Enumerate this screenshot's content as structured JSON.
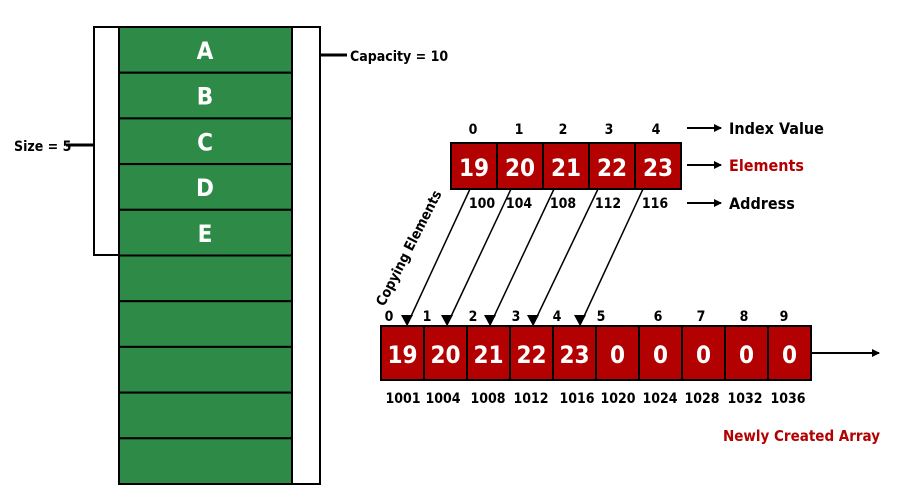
{
  "colors": {
    "green": "#2e8b47",
    "red": "#b30000",
    "label_red": "#b30000",
    "stroke": "#000000"
  },
  "capacity_stack": {
    "cells": [
      "A",
      "B",
      "C",
      "D",
      "E",
      "",
      "",
      "",
      "",
      ""
    ],
    "size_label": "Size = 5",
    "capacity_label": "Capacity = 10"
  },
  "old_array": {
    "indices": [
      "0",
      "1",
      "2",
      "3",
      "4"
    ],
    "elements": [
      "19",
      "20",
      "21",
      "22",
      "23"
    ],
    "addresses": [
      "100",
      "104",
      "108",
      "112",
      "116"
    ]
  },
  "legend": {
    "index_label": "Index Value",
    "elements_label": "Elements",
    "address_label": "Address"
  },
  "copy_label": "Copying Elements",
  "new_array": {
    "indices": [
      "0",
      "1",
      "2",
      "3",
      "4",
      "5",
      "6",
      "7",
      "8",
      "9"
    ],
    "elements": [
      "19",
      "20",
      "21",
      "22",
      "23",
      "0",
      "0",
      "0",
      "0",
      "0"
    ],
    "addresses": [
      "1001",
      "1004",
      "1008",
      "1012",
      "1016",
      "1020",
      "1024",
      "1028",
      "1032",
      "1036"
    ],
    "caption": "Newly Created Array"
  }
}
